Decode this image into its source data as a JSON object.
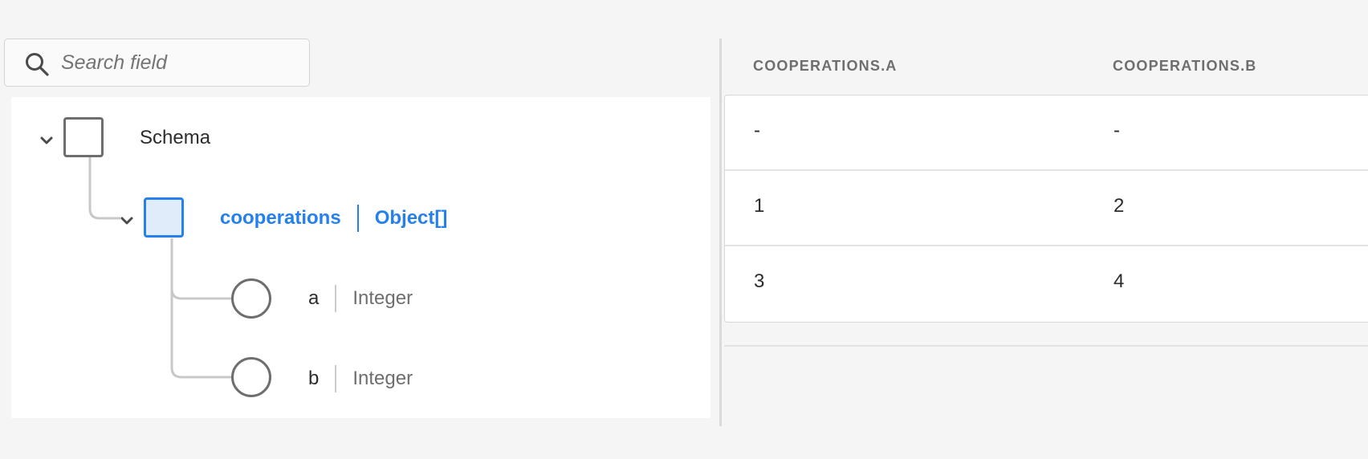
{
  "search": {
    "placeholder": "Search field",
    "icon": "search-icon"
  },
  "tree": {
    "root": {
      "label": "Schema",
      "expanded": true
    },
    "object": {
      "name": "cooperations",
      "type": "Object[]",
      "selected": true,
      "expanded": true
    },
    "fields": [
      {
        "name": "a",
        "type": "Integer"
      },
      {
        "name": "b",
        "type": "Integer"
      }
    ]
  },
  "table": {
    "columns": [
      "COOPERATIONS.A",
      "COOPERATIONS.B"
    ],
    "rows": [
      [
        "-",
        "-"
      ],
      [
        "1",
        "2"
      ],
      [
        "3",
        "4"
      ]
    ]
  },
  "colors": {
    "accent": "#2680eb",
    "accent_fill": "#e1ecfb",
    "node_border": "#6e6e6e",
    "connector": "#c8c8c8",
    "background": "#f5f5f5"
  }
}
